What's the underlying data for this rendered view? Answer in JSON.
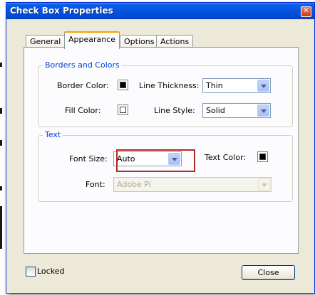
{
  "window": {
    "title": "Check Box Properties"
  },
  "tabs": [
    {
      "label": "General"
    },
    {
      "label": "Appearance",
      "active": true
    },
    {
      "label": "Options"
    },
    {
      "label": "Actions"
    }
  ],
  "borders_colors": {
    "legend": "Borders and Colors",
    "border_color_label": "Border Color:",
    "line_thickness_label": "Line Thickness:",
    "line_thickness_value": "Thin",
    "fill_color_label": "Fill Color:",
    "line_style_label": "Line Style:",
    "line_style_value": "Solid",
    "border_color": "#000000",
    "fill_color": "#ffffff"
  },
  "text": {
    "legend": "Text",
    "font_size_label": "Font Size:",
    "font_size_value": "Auto",
    "text_color_label": "Text Color:",
    "text_color": "#000000",
    "font_label": "Font:",
    "font_value": "Adobe Pi"
  },
  "footer": {
    "locked_label": "Locked",
    "close_label": "Close"
  },
  "colors": {
    "legend_blue": "#0046d5",
    "highlight_red": "#b52828",
    "tab_accent": "#f7a100"
  }
}
